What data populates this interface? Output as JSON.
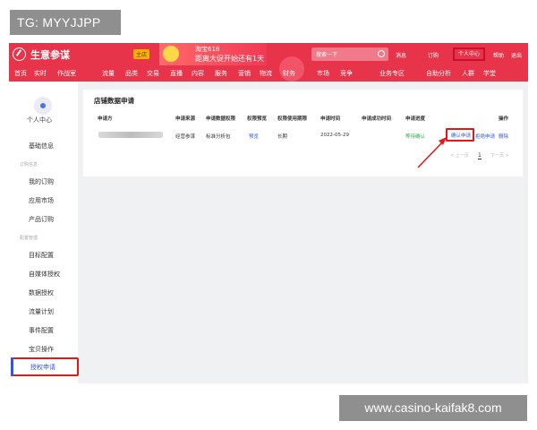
{
  "watermarks": {
    "top": "TG: MYYJJPP",
    "bottom": "www.casino-kaifak8.com"
  },
  "topbar": {
    "brand": "生意参谋",
    "store_badge": "主店",
    "promo_line1": "淘宝618",
    "promo_line2": "距离大促开始还有1天",
    "search_placeholder": "搜索一下",
    "links": [
      "消息",
      "订购",
      "个人中心",
      "帮助",
      "退出"
    ],
    "personal_center": "个人中心"
  },
  "navbar": {
    "items": [
      "首页",
      "实时",
      "作战室",
      "流量",
      "品类",
      "交易",
      "直播",
      "内容",
      "服务",
      "营销",
      "物流",
      "财务",
      "市场",
      "竞争",
      "业务专区",
      "自助分析",
      "人群",
      "学堂"
    ]
  },
  "sidebar": {
    "user_label": "个人中心",
    "basic_info": "基础信息",
    "group_orders": "订购信息",
    "my_orders": "我的订购",
    "app_market": "应用市场",
    "product_orders": "产品订购",
    "group_config": "配置管理",
    "target_config": "目标配置",
    "self_media_auth": "自媒体授权",
    "data_auth": "数据授权",
    "traffic_plan": "流量计划",
    "event_config": "事件配置",
    "item_ops": "宝贝操作",
    "auth_apply": "授权申请"
  },
  "panel": {
    "title": "店铺数据申请",
    "columns": [
      "申请方",
      "申请来源",
      "申请数据权限",
      "权限预览",
      "权限使用期限",
      "申请时间",
      "申请成功时间",
      "申请进度",
      "操作"
    ],
    "row": {
      "source": "经营参谋",
      "permission": "标准分析包",
      "preview": "预览",
      "period": "长期",
      "time": "2022-05-29",
      "progress": "等待确认",
      "action_confirm": "确认申请",
      "action_reject": "拒绝申请",
      "action_delete": "删除"
    },
    "pager": {
      "prev": "< 上一页",
      "page": "1",
      "next": "下一页 >"
    }
  },
  "colors": {
    "brand_red": "#e8344a",
    "highlight_red": "#e0191b",
    "link_blue": "#2f5bd8",
    "status_green": "#2eaa4a"
  }
}
